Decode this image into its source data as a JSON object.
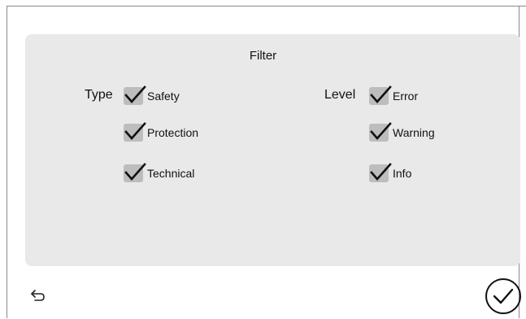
{
  "dialog": {
    "title": "Filter"
  },
  "type_group": {
    "label": "Type",
    "options": [
      {
        "label": "Safety",
        "checked": true
      },
      {
        "label": "Protection",
        "checked": true
      },
      {
        "label": "Technical",
        "checked": true
      }
    ]
  },
  "level_group": {
    "label": "Level",
    "options": [
      {
        "label": "Error",
        "checked": true
      },
      {
        "label": "Warning",
        "checked": true
      },
      {
        "label": "Info",
        "checked": true
      }
    ]
  },
  "footer": {
    "back_icon": "undo-arrow-icon",
    "confirm_icon": "circle-check-icon"
  },
  "colors": {
    "panel": "#e9e9e9",
    "checkbox": "#bdbdbd",
    "check": "#111111"
  }
}
